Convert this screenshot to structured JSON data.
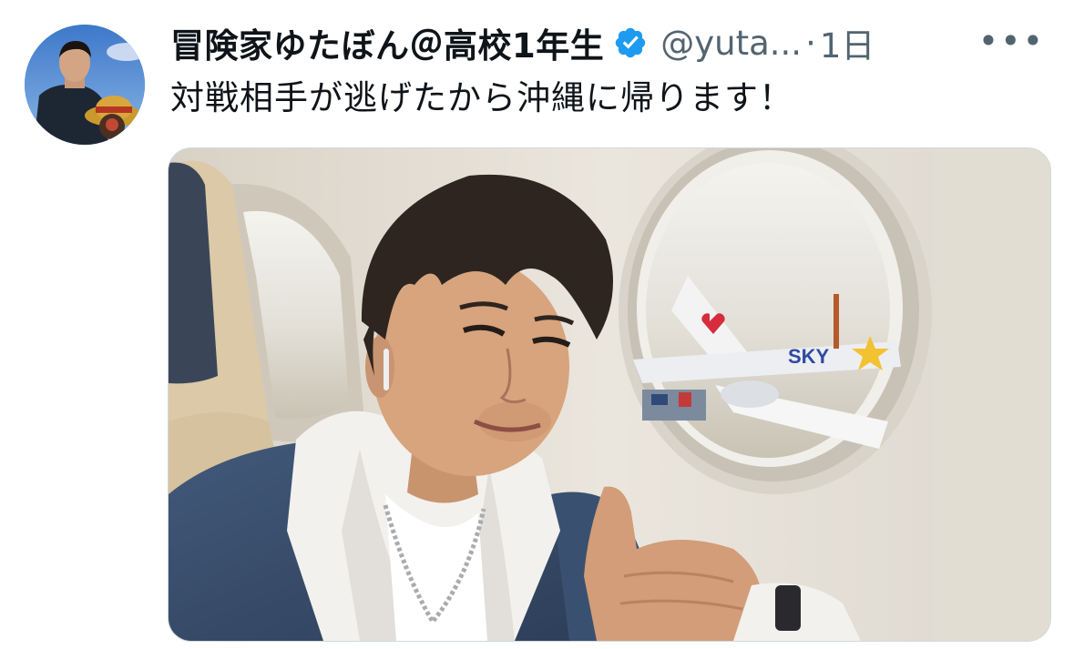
{
  "tweet": {
    "display_name": "冒険家ゆたぼん＠高校1年生",
    "handle": "@yuta...",
    "separator": "·",
    "timestamp": "1日",
    "more_label": "•••",
    "text": "対戦相手が逃げたから沖縄に帰ります！",
    "verified": true,
    "media_alt": "機内の窓際でサムズアップする少年の写真"
  },
  "media_photo": {
    "tail_text": "SKY"
  },
  "colors": {
    "verified_badge": "#1d9bf0",
    "secondary_text": "#536471",
    "primary_text": "#0f1419"
  }
}
